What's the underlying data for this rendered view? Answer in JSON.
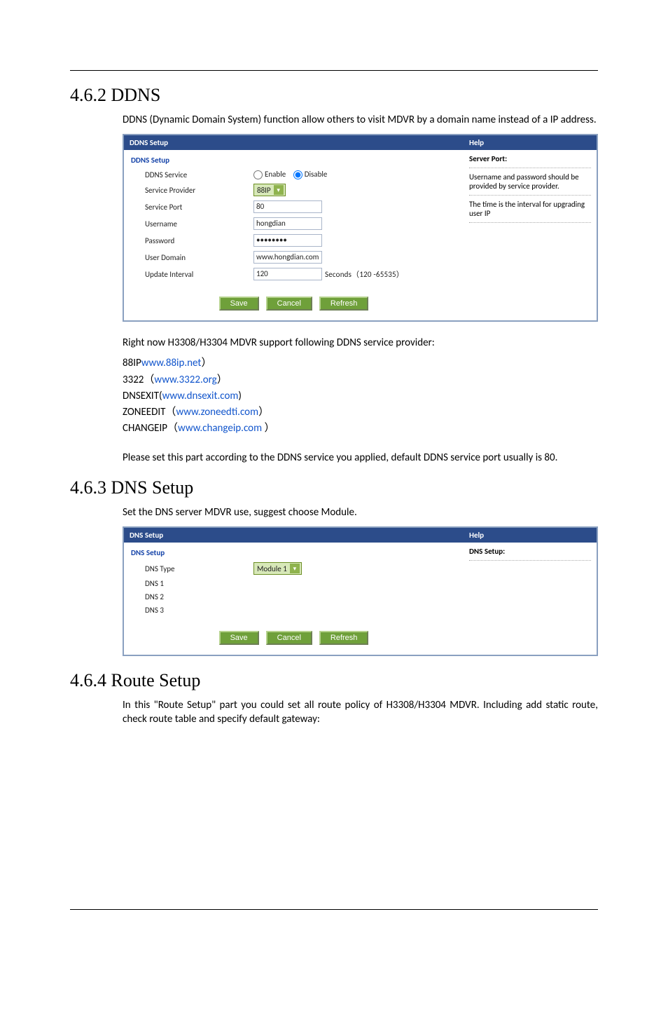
{
  "section_ddns": {
    "heading": "4.6.2 DDNS",
    "intro": "DDNS (Dynamic Domain System) function allow others to visit MDVR by a    domain name instead of a IP address.",
    "after": "Right now H3308/H3304 MDVR support following DDNS service provider:",
    "note": "Please set this part according to the DDNS service you applied, default DDNS service port usually is 80."
  },
  "providers": [
    {
      "prefix": "88IP",
      "link": "www.88ip.net",
      "suffix": "）"
    },
    {
      "prefix": "3322（",
      "link": "www.3322.org",
      "suffix": "）"
    },
    {
      "prefix": "DNSEXIT(",
      "link": "www.dnsexit.com",
      "suffix": ")"
    },
    {
      "prefix": "ZONEEDIT（",
      "link": "www.zoneedti.com",
      "suffix": "）"
    },
    {
      "prefix": "CHANGEIP（",
      "link": "www.changeip.com",
      "suffix": "  ）"
    }
  ],
  "ddns_panel": {
    "title": "DDNS Setup",
    "help_title": "Help",
    "section": "DDNS Setup",
    "rows": {
      "service": "DDNS Service",
      "enable": "Enable",
      "disable": "Disable",
      "provider": "Service Provider",
      "provider_val": "88IP",
      "port": "Service Port",
      "port_val": "80",
      "username": "Username",
      "username_val": "hongdian",
      "password": "Password",
      "password_val": "••••••••",
      "domain": "User Domain",
      "domain_val": "www.hongdian.com",
      "interval": "Update Interval",
      "interval_val": "120",
      "interval_hint": "Seconds（120 -65535）"
    },
    "help": {
      "h1": "Server Port:",
      "p1": "Username and password should be provided by service provider.",
      "p2": "The time is the interval for upgrading user IP"
    },
    "buttons": {
      "save": "Save",
      "cancel": "Cancel",
      "refresh": "Refresh"
    }
  },
  "section_dns": {
    "heading": "4.6.3 DNS Setup",
    "intro": "Set the DNS server MDVR use, suggest choose Module."
  },
  "dns_panel": {
    "title": "DNS Setup",
    "help_title": "Help",
    "section": "DNS Setup",
    "rows": {
      "type": "DNS Type",
      "type_val": "Module 1",
      "d1": "DNS 1",
      "d2": "DNS 2",
      "d3": "DNS 3"
    },
    "help": {
      "h1": "DNS Setup:"
    },
    "buttons": {
      "save": "Save",
      "cancel": "Cancel",
      "refresh": "Refresh"
    }
  },
  "section_route": {
    "heading": "4.6.4 Route Setup",
    "intro": "In this \"Route Setup\" part you could set all route policy of H3308/H3304 MDVR. Including add static route, check route table and specify default gateway:"
  }
}
